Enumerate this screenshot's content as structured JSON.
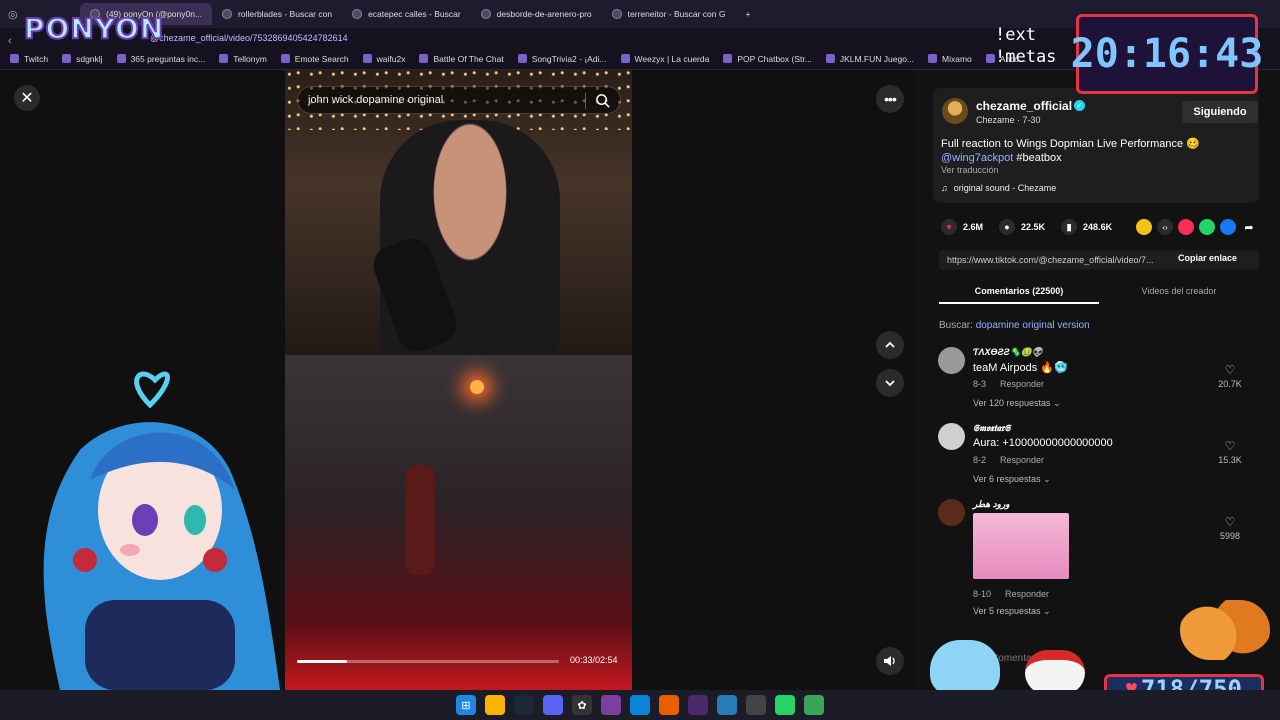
{
  "browser": {
    "tabs": [
      {
        "label": "(49) ponyOn (@pony0n..."
      },
      {
        "label": "rollerblades - Buscar con"
      },
      {
        "label": "ecatepec calles - Buscar"
      },
      {
        "label": "desborde-de-arenero-pro"
      },
      {
        "label": "terreneitor - Buscar con G"
      }
    ],
    "new_tab": "+",
    "url": "@chezame_official/video/7532869405424782614",
    "bookmarks": [
      {
        "label": "Twitch"
      },
      {
        "label": "sdgnklj"
      },
      {
        "label": "365 preguntas inc..."
      },
      {
        "label": "Tellonym"
      },
      {
        "label": "Emote Search"
      },
      {
        "label": "waifu2x"
      },
      {
        "label": "Battle Of The Chat"
      },
      {
        "label": "SongTrivia2 - ¡Adi..."
      },
      {
        "label": "Weezyx | La cuerda"
      },
      {
        "label": "POP Chatbox (Str..."
      },
      {
        "label": "JKLM.FUN Juego..."
      },
      {
        "label": "Mixamo"
      },
      {
        "label": "Anco..."
      }
    ]
  },
  "overlay": {
    "logo": "PONYON",
    "clock": "20:16:43",
    "command_line1": "!ext",
    "command_line2": "!metas",
    "goal": "718/750"
  },
  "player": {
    "search_query": "john wick dopamine original",
    "time": "00:33/02:54",
    "progress": 0.19
  },
  "post": {
    "creator_name": "chezame_official",
    "creator_sub": "Chezame · 7-30",
    "follow_label": "Siguiendo",
    "description": "Full reaction to Wings Dopmian Live Performance 🥴",
    "mention": "@wing7ackpot",
    "hashtag": "#beatbox",
    "translate": "Ver traducción",
    "sound": "original sound - Chezame",
    "likes": "2.6M",
    "comments": "22.5K",
    "saves": "248.6K",
    "link": "https://www.tiktok.com/@chezame_official/video/7...",
    "copy_label": "Copiar enlace",
    "tab_comments": "Comentarios (22500)",
    "tab_creator": "Videos del creador",
    "search_prefix": "Buscar:",
    "search_suggestion": "dopamine original version"
  },
  "comments": [
    {
      "name": "ƬΛXӨƧƧ🦠🤢👽",
      "text": "teaM Airpods 🔥🥶",
      "date": "8-3",
      "reply": "Responder",
      "replies": "Ver 120 respuestas",
      "likes": "20.7K",
      "color": "#9a9a9a"
    },
    {
      "name": "𝕾𝖒𝖔𝖝𝖙𝖆𝖗𝕾",
      "text": "Aura: +10000000000000000",
      "date": "8-2",
      "reply": "Responder",
      "replies": "Ver 6 respuestas",
      "likes": "15.3K",
      "color": "#cfcfcf"
    },
    {
      "name": "ورود هطر",
      "text": "",
      "date": "8-10",
      "reply": "Responder",
      "replies": "Ver 5 respuestas",
      "likes": "5998",
      "color": "#5a2a1a"
    }
  ],
  "comment_input_placeholder": "Comentario..."
}
